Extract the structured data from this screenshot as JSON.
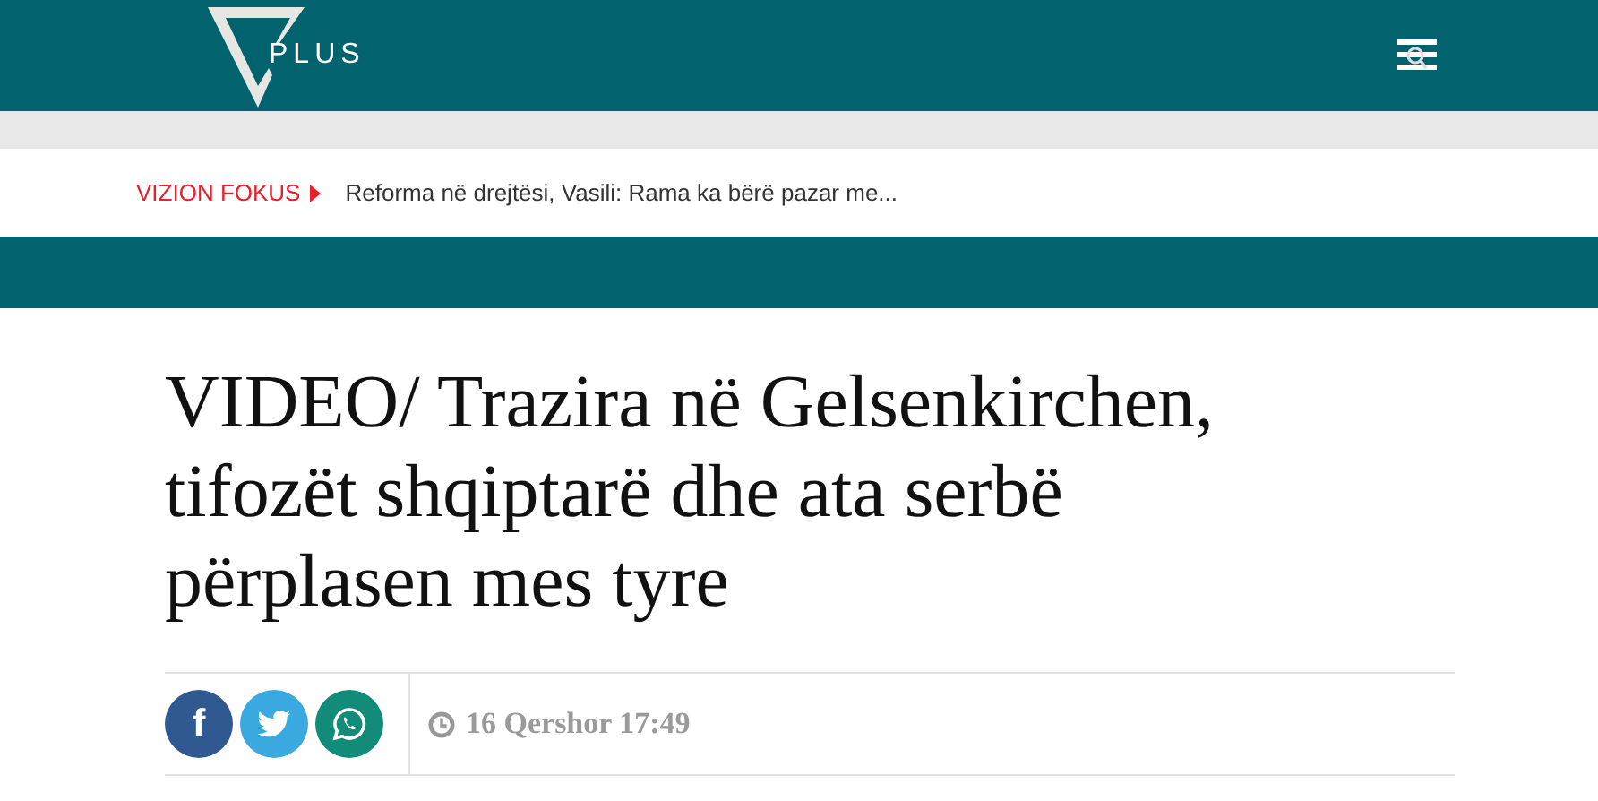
{
  "header": {
    "logo_text": "PLUS"
  },
  "ticker": {
    "label": "VIZION FOKUS",
    "headline": "Reforma në drejtësi, Vasili: Rama ka bërë pazar me..."
  },
  "article": {
    "title": "VIDEO/ Trazira në Gelsenkirchen, tifozët shqiptarë dhe ata serbë përplasen mes tyre",
    "share": [
      {
        "kind": "facebook",
        "glyph": "f",
        "color": "#305891"
      },
      {
        "kind": "twitter",
        "color": "#3aa9e0"
      },
      {
        "kind": "whatsapp",
        "color": "#138b79"
      }
    ],
    "date": "16 Qershor 17:49"
  }
}
